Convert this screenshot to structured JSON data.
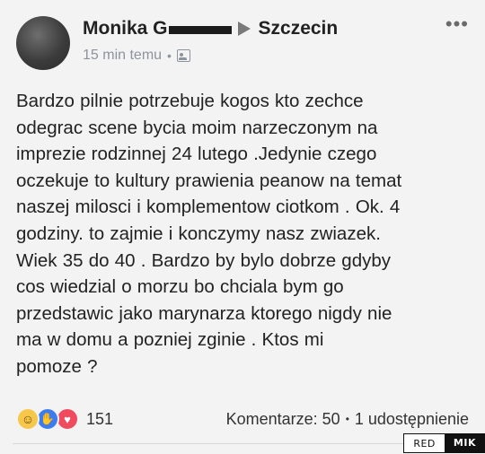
{
  "post": {
    "author": "Monika G",
    "group": "Szczecin",
    "time": "15 min temu",
    "body": "Bardzo pilnie potrzebuje kogos kto zechce\nodegrac scene bycia moim narzeczonym na\nimprezie rodzinnej 24 lutego .Jedynie czego\noczekuje to kultury prawienia peanow na temat\nnaszej milosci i komplementow ciotkom . Ok. 4\ngodziny. to zajmie i konczymy nasz zwiazek.\nWiek 35 do 40 . Bardzo by bylo dobrze gdyby\ncos wiedzial o morzu bo chciala bym go\nprzedstawic jako marynarza ktorego nigdy nie\nma w domu a pozniej zginie . Ktos mi\npomoze ?"
  },
  "footer": {
    "reaction_count": "151",
    "comments": "Komentarze: 50",
    "shares": "1 udostępnienie"
  },
  "icons": {
    "audience": "group-audience-icon",
    "menu": "more-options-icon",
    "reactions": [
      "haha-reaction-icon",
      "like-reaction-icon",
      "love-reaction-icon"
    ]
  },
  "watermark": {
    "left": "RED",
    "right": "MIK"
  },
  "colors": {
    "like": "#3b7cf0",
    "love": "#f04a5e",
    "haha": "#f7c74a"
  }
}
